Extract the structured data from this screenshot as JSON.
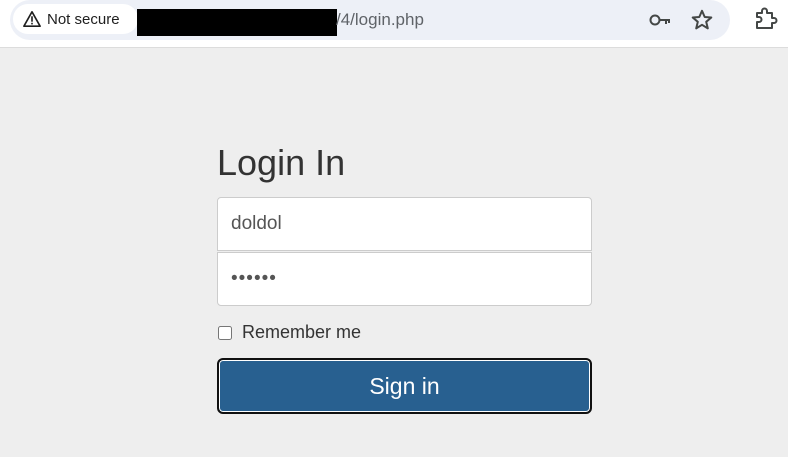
{
  "browser": {
    "security_label": "Not secure",
    "url_path": "/4/login.php"
  },
  "login": {
    "heading": "Login In",
    "username_value": "doldol",
    "password_value": "••••••",
    "remember_label": "Remember me",
    "signin_label": "Sign in"
  },
  "colors": {
    "page_background": "#eeeeee",
    "button_primary": "#286090",
    "omnibox_background": "#edf0f7"
  }
}
